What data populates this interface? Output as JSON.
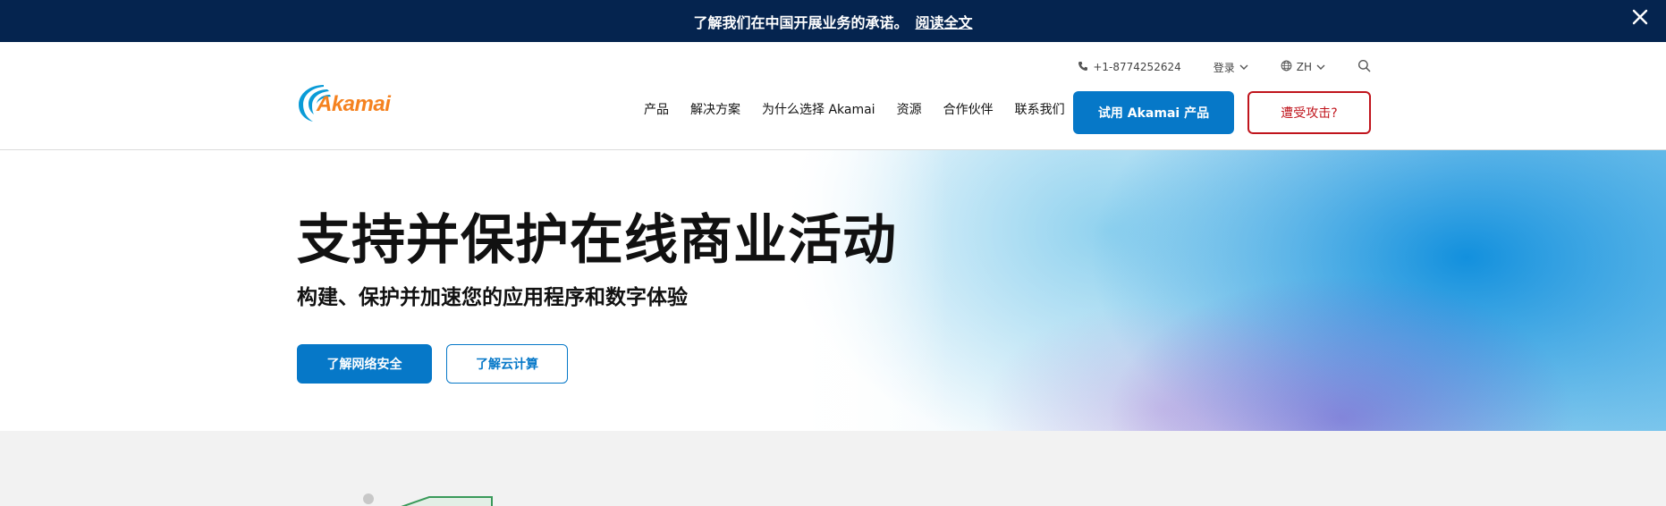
{
  "announcement": {
    "text": "了解我们在中国开展业务的承诺。",
    "link": "阅读全文"
  },
  "header": {
    "phone": "+1-8774252624",
    "login": "登录",
    "language": "ZH",
    "logo_text": "Akamai",
    "nav": [
      "产品",
      "解决方案",
      "为什么选择 Akamai",
      "资源",
      "合作伙伴",
      "联系我们"
    ],
    "try_button": "试用 Akamai 产品",
    "attack_button": "遭受攻击?"
  },
  "hero": {
    "title": "支持并保护在线商业活动",
    "subtitle": "构建、保护并加速您的应用程序和数字体验",
    "primary_button": "了解网络安全",
    "secondary_button": "了解云计算"
  },
  "colors": {
    "announce_bg": "#05244f",
    "brand_blue": "#0678c8",
    "brand_orange": "#f58220",
    "alert_red": "#c0141c"
  },
  "icons": {
    "close": "close-icon",
    "phone": "phone-icon",
    "chevron": "chevron-down-icon",
    "globe": "globe-icon",
    "search": "search-icon"
  }
}
